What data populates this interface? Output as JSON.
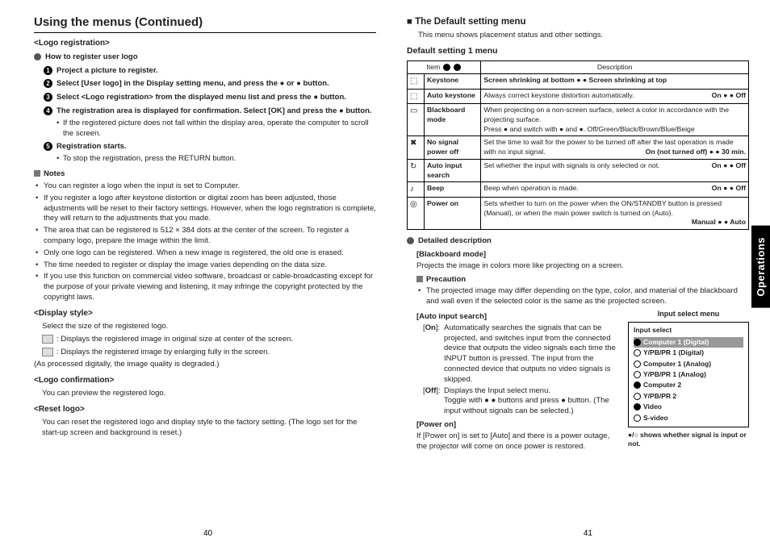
{
  "mainTitle": "Using the menus (Continued)",
  "left": {
    "logoReg": "<Logo registration>",
    "howTo": "How to register user logo",
    "steps": {
      "s1": "Project a picture to register.",
      "s2": "Select [User logo] in the Display setting menu, and press the ● or ● button.",
      "s3": "Select <Logo registration> from the displayed menu list and press the ● button.",
      "s4": "The registration area is displayed for confirmation. Select [OK] and press the ● button.",
      "s4sub": "If the registered picture does not fall within the display area, operate the computer to scroll the screen.",
      "s5": "Registration starts.",
      "s5sub": "To stop the registration, press the RETURN button."
    },
    "notesHead": "Notes",
    "notes": [
      "You can register a logo when the input is set to Computer.",
      "If you register a logo after keystone distortion or digital zoom has been adjusted, those adjustments will be reset to their factory settings. However, when the logo registration is complete, they will return to the adjustments that you made.",
      "The area that can be registered is 512 × 384 dots at the center of the screen. To register a company logo, prepare the image within the limit.",
      "Only one logo can be registered. When a new image is registered, the old one is erased.",
      "The time needed to register or display the image varies depending on the data size.",
      "If you use this function on commercial video software, broadcast or cable-broadcasting except for the purpose of your private viewing and listening, it may infringe the copyright protected by the copyright laws."
    ],
    "dispStyle": "<Display style>",
    "dispStyleDesc": "Select the size of the registered logo.",
    "dispItems": [
      ": Displays the registered image in original size at center of the screen.",
      ": Displays the registered image by enlarging fully in the screen."
    ],
    "dispNote": "(As processed digitally, the image quality is degraded.)",
    "logoConf": "<Logo confirmation>",
    "logoConfDesc": "You can preview the registered logo.",
    "resetLogo": "<Reset logo>",
    "resetLogoDesc": "You can reset the registered logo and display style to the factory setting. (The logo set for the start-up screen and background is reset.)"
  },
  "right": {
    "defaultMenu": "The Default setting menu",
    "defaultMenuDesc": "This menu shows placement status and other settings.",
    "defaultSetting1": "Default setting 1 menu",
    "tableHead": {
      "item": "Item",
      "desc": "Description"
    },
    "rows": [
      {
        "icon": "⬚",
        "name": "Keystone",
        "desc": "Screen shrinking at bottom ● ● Screen shrinking at top"
      },
      {
        "icon": "⬚",
        "name": "Auto keystone",
        "desc": "Always correct keystone distortion automatically.",
        "right": "On ● ● Off"
      },
      {
        "icon": "▭",
        "name": "Blackboard mode",
        "desc": "When projecting on a non-screen surface, select a color in accordance with the projecting surface.\nPress ● and switch with ● and ●.    Off/Green/Black/Brown/Blue/Beige"
      },
      {
        "icon": "✖",
        "name": "No signal power off",
        "desc": "Set the time to wait for the power to be turned off after the last operation is made with no input signal.",
        "right": "On (not turned off) ● ● 30 min."
      },
      {
        "icon": "↻",
        "name": "Auto input search",
        "desc": "Set whether the input with signals is only selected or not.",
        "right": "On ● ● Off"
      },
      {
        "icon": "♪",
        "name": "Beep",
        "desc": "Beep when operation is made.",
        "right": "On ● ● Off"
      },
      {
        "icon": "◎",
        "name": "Power on",
        "desc": "Sets whether to turn on the power when the ON/STANDBY button is pressed (Manual), or when the main power switch is turned on (Auto).",
        "right": "Manual ● ● Auto"
      }
    ],
    "detailedDesc": "Detailed description",
    "blackboard": {
      "label": "[Blackboard mode]",
      "text": "Projects the image in colors more like projecting on a screen."
    },
    "precautionHead": "Precaution",
    "precaution": "The projected image may differ depending on the type, color, and material of the blackboard and wall even if the selected color is the same as the projected screen.",
    "autoInput": {
      "label": "[Auto input search]",
      "on": "Automatically searches the signals that can be projected, and switches input from the connected device that outputs the video signals each time the INPUT button is pressed. The input from the connected device that outputs no video signals is skipped.",
      "off": "Displays the Input select menu.\nToggle with ● ● buttons and press ● button. (The input without signals can be selected.)"
    },
    "powerOn": {
      "label": "[Power on]",
      "text": "If [Power on] is set to [Auto] and there is a power outage, the projector will come on once power is restored."
    },
    "inputMenu": {
      "title": "Input select menu",
      "head": "Input select",
      "items": [
        {
          "label": "Computer 1 (Digital)",
          "filled": true,
          "hl": true
        },
        {
          "label": "Y/PB/PR 1 (Digital)",
          "filled": false
        },
        {
          "label": "Computer 1 (Analog)",
          "filled": false
        },
        {
          "label": "Y/PB/PR 1 (Analog)",
          "filled": false
        },
        {
          "label": "Computer 2",
          "filled": true
        },
        {
          "label": "Y/PB/PR 2",
          "filled": false
        },
        {
          "label": "Video",
          "filled": true
        },
        {
          "label": "S-video",
          "filled": false
        }
      ],
      "note": "●/○ shows whether signal is input or not."
    }
  },
  "pageLeft": "40",
  "pageRight": "41",
  "sideTab": "Operations"
}
